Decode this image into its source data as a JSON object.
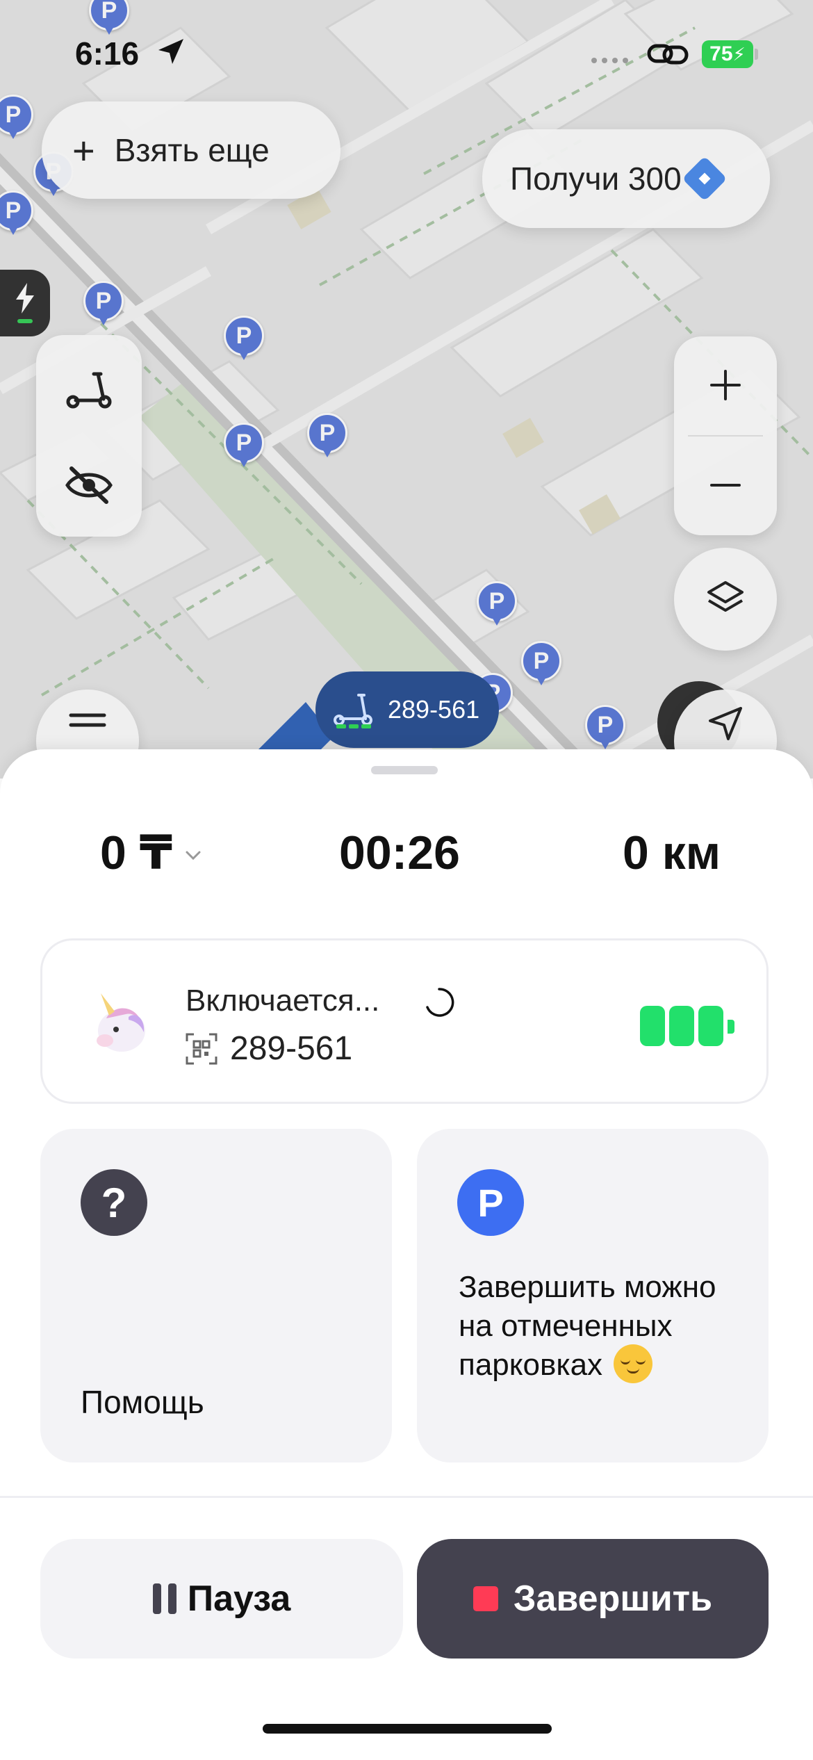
{
  "status_bar": {
    "time": "6:16",
    "battery": "75"
  },
  "map": {
    "take_more_label": "Взять еще",
    "bonus_label": "Получи 300",
    "parking_letter": "P",
    "scooter_tag_id": "289-561"
  },
  "ride": {
    "cost": "0 ₸",
    "timer": "00:26",
    "distance": "0 км"
  },
  "scooter": {
    "status": "Включается...",
    "id": "289-561"
  },
  "tiles": {
    "help_label": "Помощь",
    "parking_letter": "P",
    "parking_note": "Завершить можно на отмеченных парковках"
  },
  "actions": {
    "pause_label": "Пауза",
    "finish_label": "Завершить"
  },
  "colors": {
    "accent_green": "#2fcf53",
    "parking_blue": "#3d6ef2",
    "dark_button": "#44424f",
    "stop_red": "#ff3b55"
  }
}
